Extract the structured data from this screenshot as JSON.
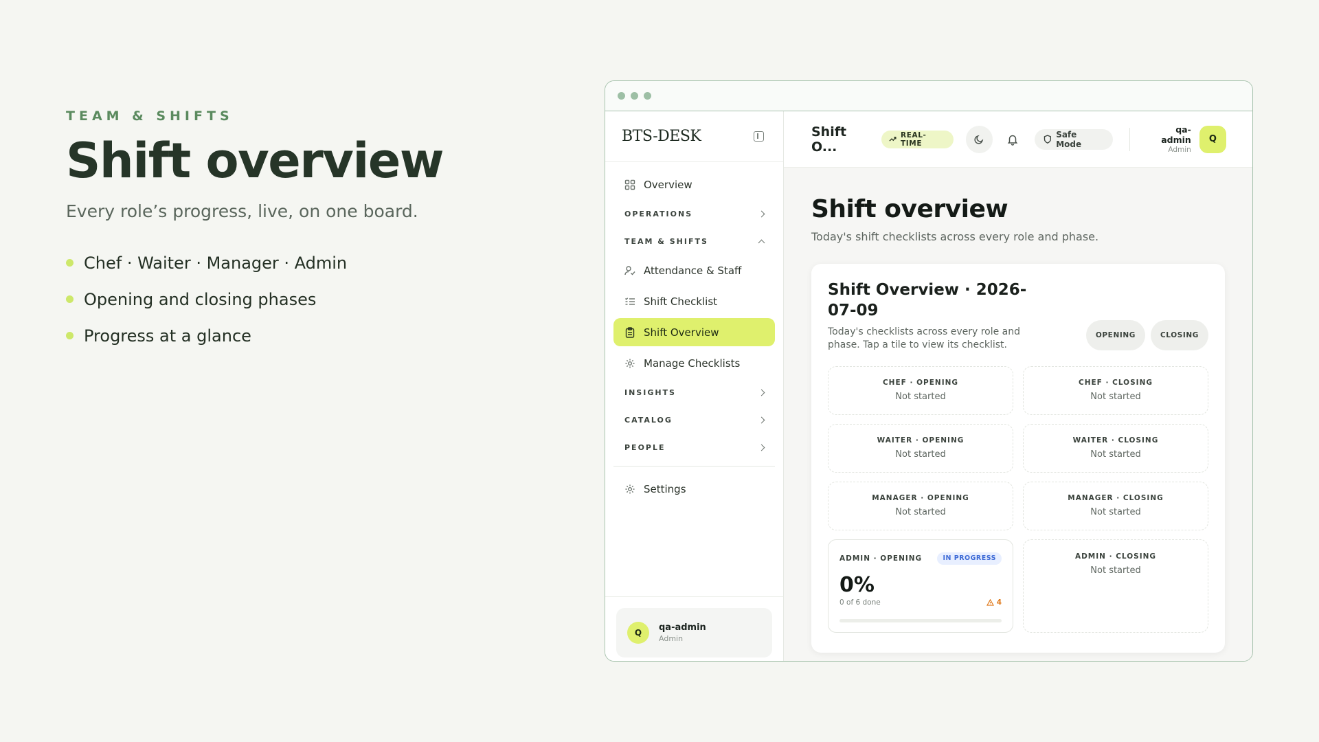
{
  "promo": {
    "eyebrow": "TEAM & SHIFTS",
    "title": "Shift overview",
    "subtitle": "Every role’s progress, live, on one board.",
    "bullets": [
      "Chef · Waiter · Manager · Admin",
      "Opening and closing phases",
      "Progress at a glance"
    ],
    "accent_color": "#cde86a"
  },
  "app": {
    "logo": "BTS-DESK",
    "sidebar": {
      "overview": "Overview",
      "sections": {
        "operations": "OPERATIONS",
        "team_shifts": "TEAM & SHIFTS",
        "insights": "INSIGHTS",
        "catalog": "CATALOG",
        "people": "PEOPLE"
      },
      "team_items": [
        {
          "label": "Attendance & Staff",
          "icon": "user-check-icon"
        },
        {
          "label": "Shift Checklist",
          "icon": "list-check-icon"
        },
        {
          "label": "Shift Overview",
          "icon": "clipboard-icon",
          "active": true
        },
        {
          "label": "Manage Checklists",
          "icon": "gear-icon"
        }
      ],
      "settings": "Settings",
      "user": {
        "initial": "Q",
        "name": "qa-admin",
        "role": "Admin"
      }
    },
    "topbar": {
      "title": "Shift O...",
      "realtime": "REAL-TIME",
      "safe_mode": "Safe Mode",
      "user": {
        "initial": "Q",
        "name": "qa-admin",
        "role": "Admin"
      }
    },
    "page": {
      "title": "Shift overview",
      "subtitle": "Today's shift checklists across every role and phase."
    },
    "card": {
      "title": "Shift Overview · 2026-07-09",
      "description": "Today's checklists across every role and phase. Tap a tile to view its checklist.",
      "phases": [
        "OPENING",
        "CLOSING"
      ],
      "tiles": [
        {
          "role": "CHEF · OPENING",
          "status": "Not started"
        },
        {
          "role": "CHEF · CLOSING",
          "status": "Not started"
        },
        {
          "role": "WAITER · OPENING",
          "status": "Not started"
        },
        {
          "role": "WAITER · CLOSING",
          "status": "Not started"
        },
        {
          "role": "MANAGER · OPENING",
          "status": "Not started"
        },
        {
          "role": "MANAGER · CLOSING",
          "status": "Not started"
        },
        {
          "role": "ADMIN · OPENING",
          "badge": "IN PROGRESS",
          "percent": "0%",
          "done_text": "0 of 6 done",
          "warnings": "4",
          "progress": 0
        },
        {
          "role": "ADMIN · CLOSING",
          "status": "Not started"
        }
      ]
    }
  },
  "colors": {
    "accent_lime": "#dff06d",
    "brand_green": "#5a8a5e",
    "badge_blue": "#3d6ad6",
    "warning_orange": "#e07a1c"
  }
}
